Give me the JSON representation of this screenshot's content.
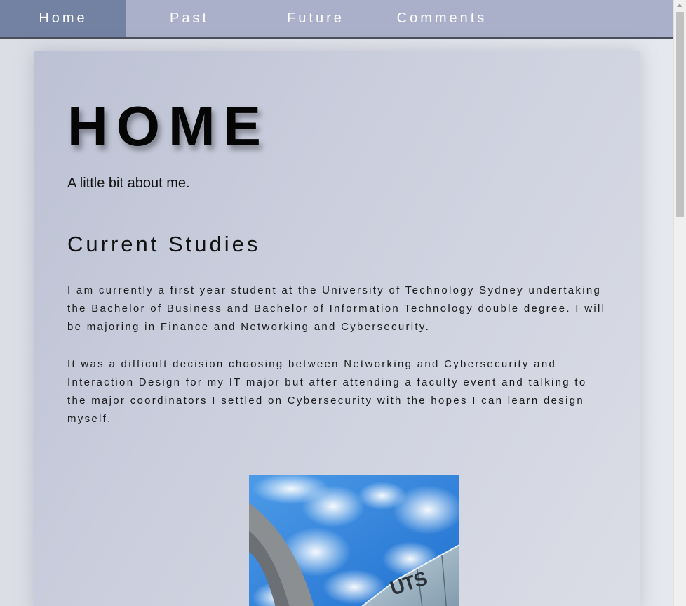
{
  "nav": {
    "items": [
      {
        "label": "Home",
        "active": true
      },
      {
        "label": "Past",
        "active": false
      },
      {
        "label": "Future",
        "active": false
      },
      {
        "label": "Comments",
        "active": false
      }
    ]
  },
  "main": {
    "title": "HOME",
    "subtitle": "A little bit about me.",
    "section_heading": "Current Studies",
    "paragraphs": [
      "I am currently a first year student at the University of Technology Sydney undertaking the Bachelor of Business and Bachelor of Information Technology double degree. I will be majoring in Finance and Networking and Cybersecurity.",
      "It was a difficult decision choosing between Networking and Cybersecurity and Interaction Design for my IT major but after attending a faculty event and talking to the major coordinators I settled on Cybersecurity with the hopes I can learn design myself."
    ],
    "photo": {
      "sign_text": "UTS",
      "icon": "campus-photo"
    }
  },
  "colors": {
    "nav_bg": "#aab0c9",
    "nav_active": "#7382a3",
    "nav_text": "#ffffff",
    "sky": "#2f86e0"
  }
}
